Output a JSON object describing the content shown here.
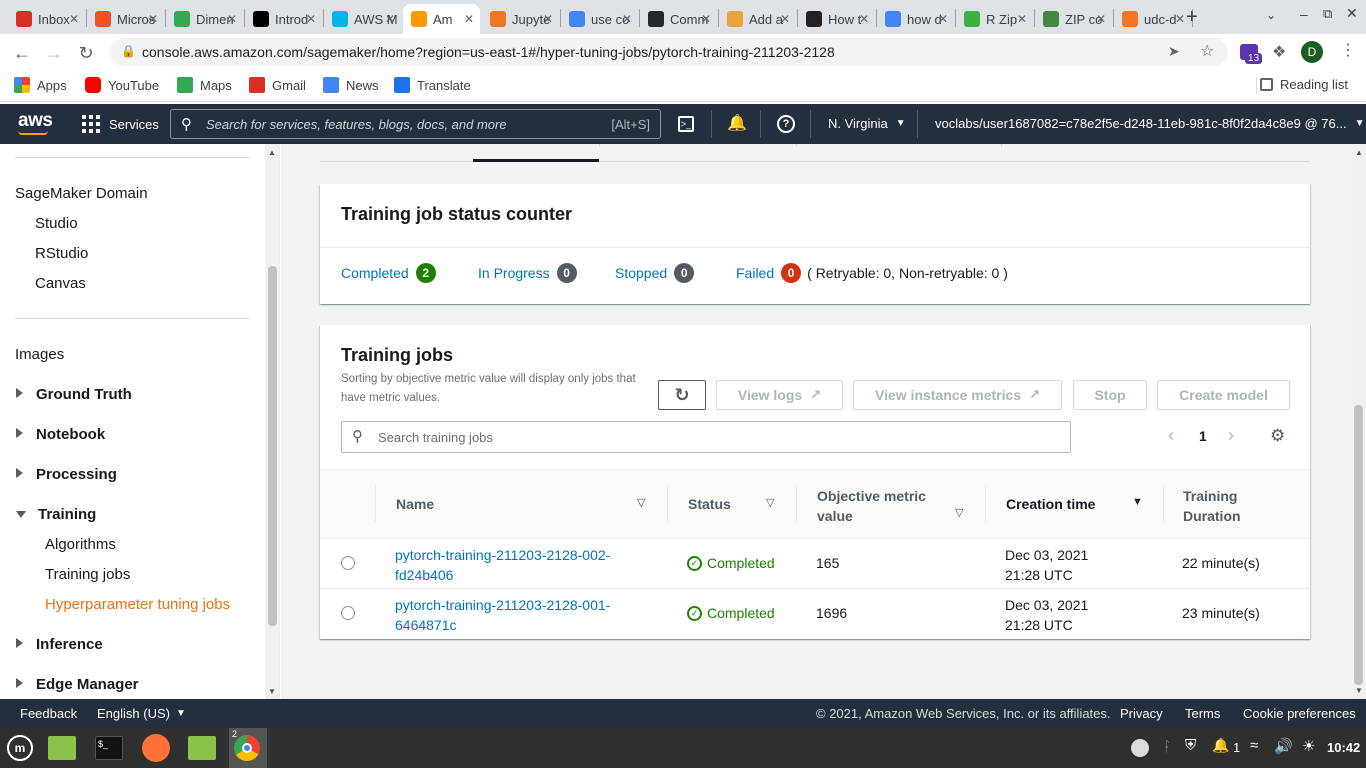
{
  "browser": {
    "tabs": [
      {
        "label": "Inbox",
        "icon": "gmail-icon",
        "color": "#d93025"
      },
      {
        "label": "Micros",
        "icon": "microsoft-icon",
        "color": "#f25022"
      },
      {
        "label": "Dimen",
        "icon": "dimensions-icon",
        "color": "#34a853"
      },
      {
        "label": "Introd",
        "icon": "medium-icon",
        "color": "#000000"
      },
      {
        "label": "AWS M",
        "icon": "udacity-icon",
        "color": "#02b3e4"
      },
      {
        "label": "Am",
        "icon": "aws-icon",
        "color": "#ff9900"
      },
      {
        "label": "Jupyte",
        "icon": "jupyter-icon",
        "color": "#f37626"
      },
      {
        "label": "use co",
        "icon": "google-icon",
        "color": "#4285f4"
      },
      {
        "label": "Comm",
        "icon": "github-icon",
        "color": "#24292e"
      },
      {
        "label": "Add a",
        "icon": "package-icon",
        "color": "#e8a33d"
      },
      {
        "label": "How t",
        "icon": "hexagon-icon",
        "color": "#222222"
      },
      {
        "label": "how d",
        "icon": "google-icon",
        "color": "#4285f4"
      },
      {
        "label": "R Zip",
        "icon": "rzip-icon",
        "color": "#3cb043"
      },
      {
        "label": "ZIP co",
        "icon": "zip-icon",
        "color": "#3f8a3f"
      },
      {
        "label": "udc-d",
        "icon": "jupyter-icon",
        "color": "#f37626"
      }
    ],
    "new_tab": "+",
    "url": "console.aws.amazon.com/sagemaker/home?region=us-east-1#/hyper-tuning-jobs/pytorch-training-211203-2128",
    "extension_badge": "13",
    "profile_initial": "D",
    "bookmarks": [
      "Apps",
      "YouTube",
      "Maps",
      "Gmail",
      "News",
      "Translate"
    ],
    "reading_list": "Reading list"
  },
  "aws": {
    "logo": "aws",
    "services": "Services",
    "search_placeholder": "Search for services, features, blogs, docs, and more",
    "search_shortcut": "[Alt+S]",
    "region": "N. Virginia",
    "account": "voclabs/user1687082=c78e2f5e-d248-11eb-981c-8f0f2da4c8e9 @ 76..."
  },
  "sidebar": {
    "domain_title": "SageMaker Domain",
    "domain_items": [
      "Studio",
      "RStudio",
      "Canvas"
    ],
    "images": "Images",
    "groups": [
      "Ground Truth",
      "Notebook",
      "Processing"
    ],
    "training": "Training",
    "training_items": [
      "Algorithms",
      "Training jobs",
      "Hyperparameter tuning jobs"
    ],
    "after_groups": [
      "Inference",
      "Edge Manager"
    ]
  },
  "status_counter": {
    "title": "Training job status counter",
    "completed_label": "Completed",
    "completed_count": "2",
    "in_progress_label": "In Progress",
    "in_progress_count": "0",
    "stopped_label": "Stopped",
    "stopped_count": "0",
    "failed_label": "Failed",
    "failed_count": "0",
    "failed_detail": "( Retryable: 0, Non-retryable: 0 )",
    "colors": {
      "completed": "#1d8102",
      "neutral": "#545b64",
      "failed": "#d13212"
    }
  },
  "training_jobs": {
    "title": "Training jobs",
    "description": "Sorting by objective metric value will display only jobs that have metric values.",
    "buttons": {
      "view_logs": "View logs",
      "view_instance_metrics": "View instance metrics",
      "stop": "Stop",
      "create_model": "Create model"
    },
    "search_placeholder": "Search training jobs",
    "page": "1",
    "columns": [
      "Name",
      "Status",
      "Objective metric value",
      "Creation time",
      "Training Duration"
    ],
    "rows": [
      {
        "name": "pytorch-training-211203-2128-002-fd24b406",
        "status": "Completed",
        "metric": "165",
        "created": "Dec 03, 2021 21:28 UTC",
        "duration": "22 minute(s)"
      },
      {
        "name": "pytorch-training-211203-2128-001-6464871c",
        "status": "Completed",
        "metric": "1696",
        "created": "Dec 03, 2021 21:28 UTC",
        "duration": "23 minute(s)"
      }
    ]
  },
  "footer": {
    "feedback": "Feedback",
    "language": "English (US)",
    "copyright": "© 2021, Amazon Web Services, Inc. or its affiliates.",
    "privacy": "Privacy",
    "terms": "Terms",
    "cookies": "Cookie preferences"
  },
  "taskbar": {
    "chrome_windows": "2",
    "notifications": "1",
    "time": "10:42"
  }
}
